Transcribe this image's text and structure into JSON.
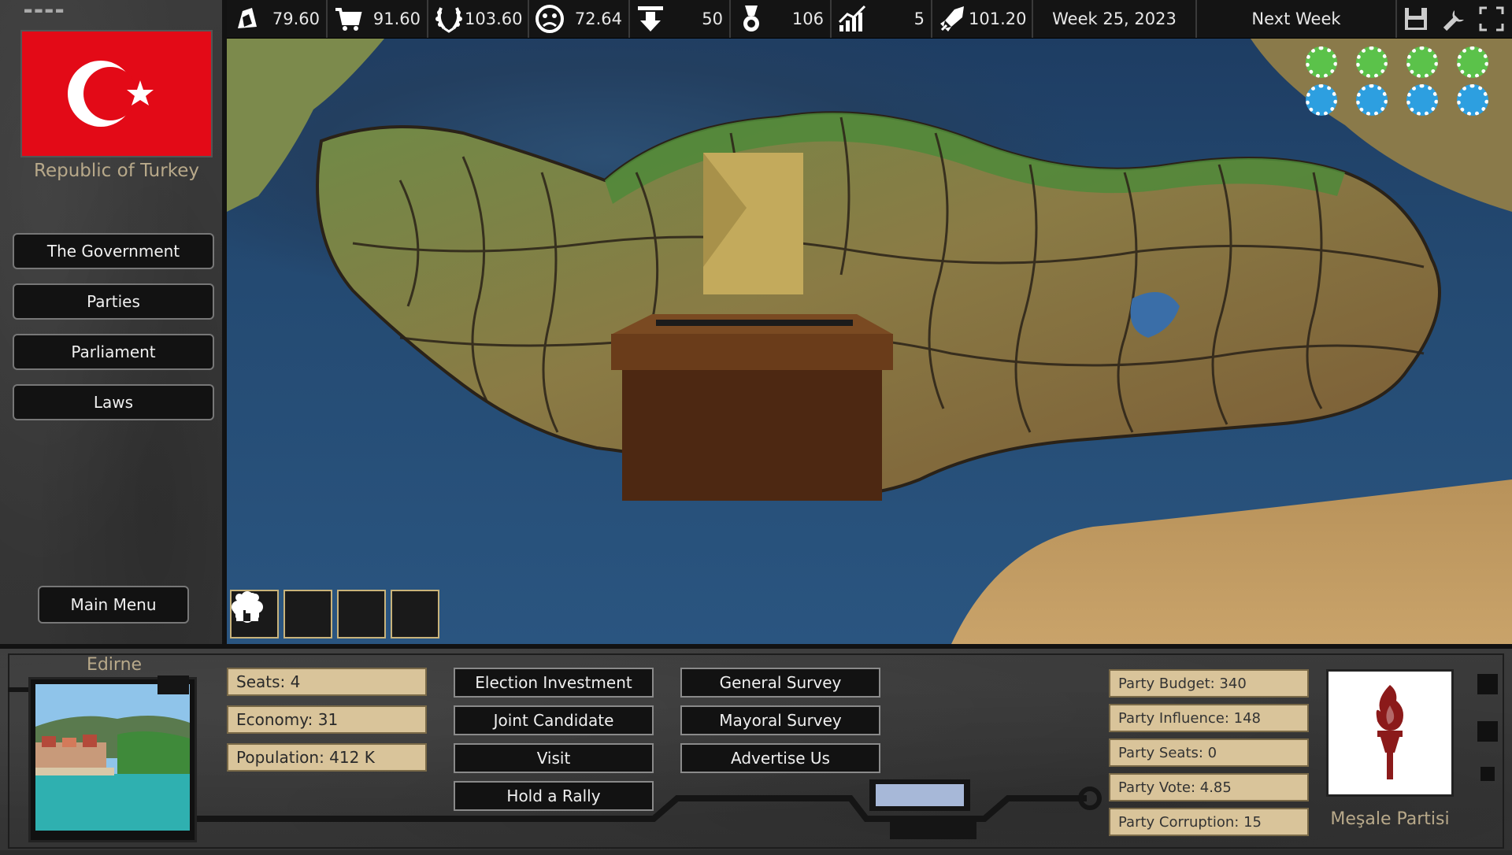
{
  "stats": [
    {
      "icon": "oil-drop-icon",
      "value": "79.60"
    },
    {
      "icon": "shopping-cart-icon",
      "value": "91.60"
    },
    {
      "icon": "laurel-wreath-icon",
      "value": "103.60"
    },
    {
      "icon": "sad-face-icon",
      "value": "72.64"
    },
    {
      "icon": "download-arrow-icon",
      "value": "50"
    },
    {
      "icon": "medal-icon",
      "value": "106"
    },
    {
      "icon": "growth-chart-icon",
      "value": "5"
    },
    {
      "icon": "rocket-icon",
      "value": "101.20"
    }
  ],
  "date": "Week 25, 2023",
  "next_week_label": "Next Week",
  "tools": [
    "save-icon",
    "wrench-icon",
    "fullscreen-icon"
  ],
  "country": {
    "name": "Republic of Turkey",
    "flag_colors": {
      "background": "#e30a17",
      "emblem": "#ffffff"
    }
  },
  "sidebar": {
    "items": [
      {
        "label": "The Government"
      },
      {
        "label": "Parties"
      },
      {
        "label": "Parliament"
      },
      {
        "label": "Laws"
      }
    ],
    "main_menu": "Main Menu"
  },
  "map": {
    "mode_buttons": [
      "flower-icon",
      "people-icon",
      "house-icon",
      "person-icon"
    ],
    "indicator_colors": {
      "green": "#5bc24a",
      "blue": "#2d9fe0"
    }
  },
  "province": {
    "name": "Edirne",
    "stats": [
      {
        "label": "Seats: 4"
      },
      {
        "label": "Economy: 31"
      },
      {
        "label": "Population: 412 K"
      }
    ]
  },
  "actions": {
    "col1": [
      {
        "label": "Election Investment"
      },
      {
        "label": "Joint Candidate"
      },
      {
        "label": "Visit"
      },
      {
        "label": "Hold a Rally"
      }
    ],
    "col2": [
      {
        "label": "General Survey"
      },
      {
        "label": "Mayoral Survey"
      },
      {
        "label": "Advertise Us"
      }
    ]
  },
  "party": {
    "stats": [
      {
        "label": "Party Budget: 340"
      },
      {
        "label": "Party Influence: 148"
      },
      {
        "label": "Party Seats: 0"
      },
      {
        "label": "Party Vote: 4.85"
      },
      {
        "label": "Party Corruption: 15"
      }
    ],
    "name": "Meşale Partisi",
    "logo_icon": "torch-icon",
    "logo_color": "#8b1a1a"
  }
}
